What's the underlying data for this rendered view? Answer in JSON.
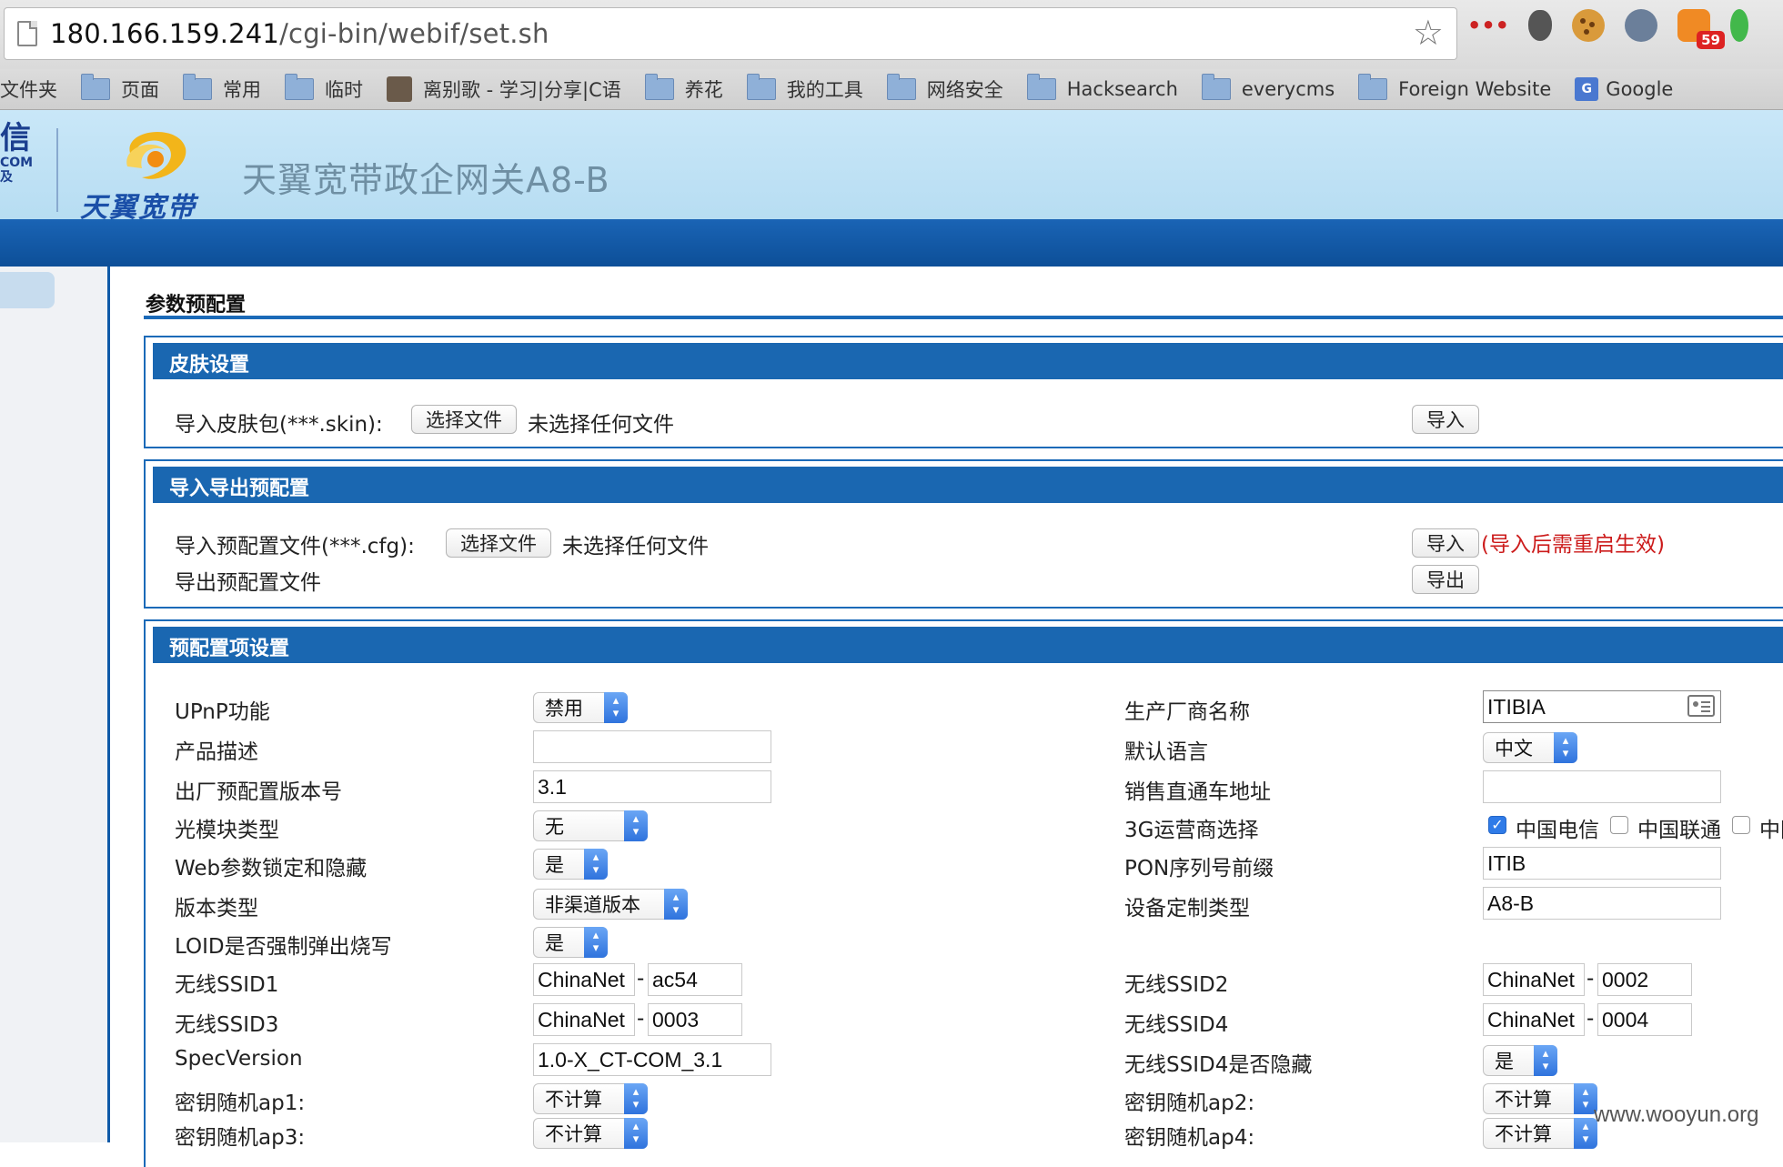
{
  "browser": {
    "url_host": "180.166.159.241",
    "url_path": "/cgi-bin/webif/set.sh",
    "rss_badge": "59"
  },
  "bookmarks": [
    {
      "label": "文件夹",
      "icon": "none"
    },
    {
      "label": "页面",
      "icon": "folder-icon"
    },
    {
      "label": "常用",
      "icon": "folder-icon"
    },
    {
      "label": "临时",
      "icon": "folder-icon"
    },
    {
      "label": "离别歌 - 学习|分享|C语",
      "icon": "avatar-icon"
    },
    {
      "label": "养花",
      "icon": "folder-icon"
    },
    {
      "label": "我的工具",
      "icon": "folder-icon"
    },
    {
      "label": "网络安全",
      "icon": "folder-icon"
    },
    {
      "label": "Hacksearch",
      "icon": "folder-icon"
    },
    {
      "label": "everycms",
      "icon": "folder-icon"
    },
    {
      "label": "Foreign Website",
      "icon": "folder-icon"
    },
    {
      "label": "Google",
      "icon": "google-translate-icon"
    }
  ],
  "header": {
    "left_logo_big": "信",
    "left_logo_small": "COM",
    "left_logo_small2": "及",
    "brand_text": "天翼宽带",
    "title": "天翼宽带政企网关A8-B"
  },
  "page": {
    "title": "参数预配置"
  },
  "skin": {
    "heading": "皮肤设置",
    "import_label": "导入皮肤包(***.skin):",
    "choose_file": "选择文件",
    "no_file": "未选择任何文件",
    "import_button": "导入"
  },
  "io": {
    "heading": "导入导出预配置",
    "import_label": "导入预配置文件(***.cfg):",
    "choose_file": "选择文件",
    "no_file": "未选择任何文件",
    "import_button": "导入",
    "import_note": "(导入后需重启生效)",
    "export_label": "导出预配置文件",
    "export_button": "导出"
  },
  "preset": {
    "heading": "预配置项设置",
    "upnp": {
      "label": "UPnP功能",
      "value": "禁用"
    },
    "product_desc": {
      "label": "产品描述",
      "value": ""
    },
    "factory_version": {
      "label": "出厂预配置版本号",
      "value": "3.1"
    },
    "optical_type": {
      "label": "光模块类型",
      "value": "无"
    },
    "web_lock": {
      "label": "Web参数锁定和隐藏",
      "value": "是"
    },
    "version_type": {
      "label": "版本类型",
      "value": "非渠道版本"
    },
    "loid_popup": {
      "label": "LOID是否强制弹出烧写",
      "value": "是"
    },
    "ssid1": {
      "label": "无线SSID1",
      "prefix": "ChinaNet",
      "suffix": "ac54"
    },
    "ssid3": {
      "label": "无线SSID3",
      "prefix": "ChinaNet",
      "suffix": "0003"
    },
    "spec_version": {
      "label": "SpecVersion",
      "value": "1.0-X_CT-COM_3.1"
    },
    "key_ap1": {
      "label": "密钥随机ap1:",
      "value": "不计算"
    },
    "key_ap3": {
      "label": "密钥随机ap3:",
      "value": "不计算"
    },
    "manufacturer": {
      "label": "生产厂商名称",
      "value": "ITIBIA"
    },
    "default_lang": {
      "label": "默认语言",
      "value": "中文"
    },
    "sales_addr": {
      "label": "销售直通车地址",
      "value": ""
    },
    "carrier_3g": {
      "label": "3G运营商选择",
      "options": [
        {
          "label": "中国电信",
          "checked": true
        },
        {
          "label": "中国联通",
          "checked": false
        },
        {
          "label": "中国",
          "checked": false
        }
      ]
    },
    "pon_prefix": {
      "label": "PON序列号前缀",
      "value": "ITIB"
    },
    "device_type": {
      "label": "设备定制类型",
      "value": "A8-B"
    },
    "ssid2": {
      "label": "无线SSID2",
      "prefix": "ChinaNet",
      "suffix": "0002"
    },
    "ssid4": {
      "label": "无线SSID4",
      "prefix": "ChinaNet",
      "suffix": "0004"
    },
    "ssid4_hidden": {
      "label": "无线SSID4是否隐藏",
      "value": "是"
    },
    "key_ap2": {
      "label": "密钥随机ap2:",
      "value": "不计算"
    },
    "key_ap4": {
      "label": "密钥随机ap4:",
      "value": "不计算"
    }
  },
  "dash": "-",
  "watermark": "www.wooyun.org"
}
